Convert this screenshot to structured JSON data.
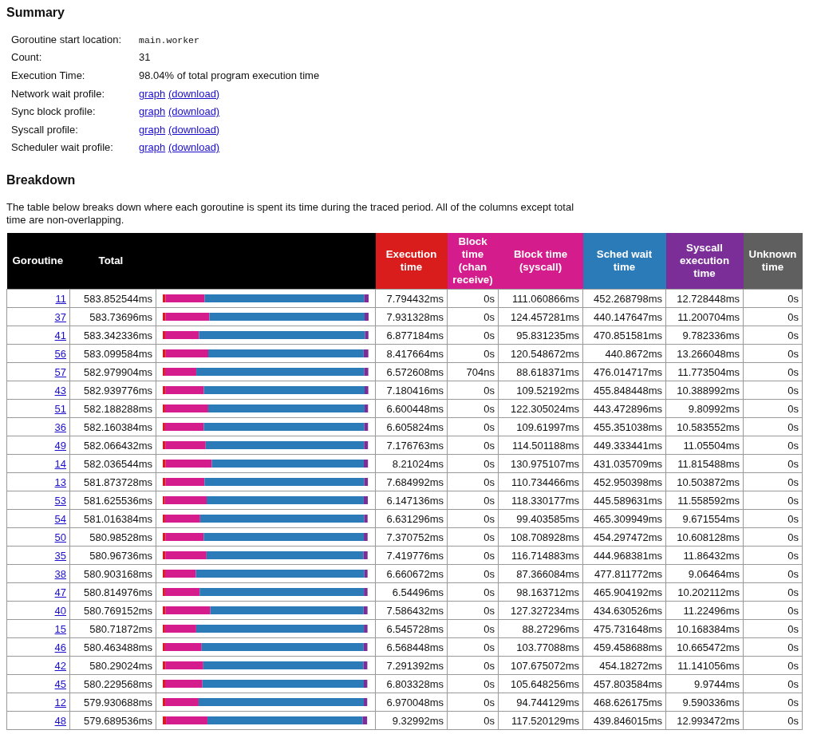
{
  "summary": {
    "heading": "Summary",
    "rows": [
      {
        "kind": "code",
        "label": "Goroutine start location:",
        "value": "main.worker"
      },
      {
        "kind": "text",
        "label": "Count:",
        "value": "31"
      },
      {
        "kind": "text",
        "label": "Execution Time:",
        "value": "98.04% of total program execution time"
      },
      {
        "kind": "links",
        "label": "Network wait profile:",
        "links": [
          "graph",
          "(download)"
        ]
      },
      {
        "kind": "links",
        "label": "Sync block profile:",
        "links": [
          "graph",
          "(download)"
        ]
      },
      {
        "kind": "links",
        "label": "Syscall profile:",
        "links": [
          "graph",
          "(download)"
        ]
      },
      {
        "kind": "links",
        "label": "Scheduler wait profile:",
        "links": [
          "graph",
          "(download)"
        ]
      }
    ]
  },
  "breakdown": {
    "heading": "Breakdown",
    "description": "The table below breaks down where each goroutine is spent its time during the traced period. All of the columns except total time are non-overlapping."
  },
  "table": {
    "columns": [
      {
        "label": "Goroutine",
        "color": "#000000"
      },
      {
        "label": "Total",
        "color": "#000000"
      },
      {
        "label": "Execution time",
        "color": "#d91c1c"
      },
      {
        "label": "Block time (chan receive)",
        "color": "#d41c8c"
      },
      {
        "label": "Block time (syscall)",
        "color": "#d41c8c"
      },
      {
        "label": "Sched wait time",
        "color": "#2b7bb9"
      },
      {
        "label": "Syscall execution time",
        "color": "#7b2e98"
      },
      {
        "label": "Unknown time",
        "color": "#5f5f5f"
      }
    ],
    "rows": [
      {
        "cells": [
          "11",
          "583.852544ms",
          "7.794432ms",
          "0s",
          "111.060866ms",
          "452.268798ms",
          "12.728448ms",
          "0s"
        ]
      },
      {
        "cells": [
          "37",
          "583.73696ms",
          "7.931328ms",
          "0s",
          "124.457281ms",
          "440.147647ms",
          "11.200704ms",
          "0s"
        ]
      },
      {
        "cells": [
          "41",
          "583.342336ms",
          "6.877184ms",
          "0s",
          "95.831235ms",
          "470.851581ms",
          "9.782336ms",
          "0s"
        ]
      },
      {
        "cells": [
          "56",
          "583.099584ms",
          "8.417664ms",
          "0s",
          "120.548672ms",
          "440.8672ms",
          "13.266048ms",
          "0s"
        ]
      },
      {
        "cells": [
          "57",
          "582.979904ms",
          "6.572608ms",
          "704ns",
          "88.618371ms",
          "476.014717ms",
          "11.773504ms",
          "0s"
        ]
      },
      {
        "cells": [
          "43",
          "582.939776ms",
          "7.180416ms",
          "0s",
          "109.52192ms",
          "455.848448ms",
          "10.388992ms",
          "0s"
        ]
      },
      {
        "cells": [
          "51",
          "582.188288ms",
          "6.600448ms",
          "0s",
          "122.305024ms",
          "443.472896ms",
          "9.80992ms",
          "0s"
        ]
      },
      {
        "cells": [
          "36",
          "582.160384ms",
          "6.605824ms",
          "0s",
          "109.61997ms",
          "455.351038ms",
          "10.583552ms",
          "0s"
        ]
      },
      {
        "cells": [
          "49",
          "582.066432ms",
          "7.176763ms",
          "0s",
          "114.501188ms",
          "449.333441ms",
          "11.05504ms",
          "0s"
        ]
      },
      {
        "cells": [
          "14",
          "582.036544ms",
          "8.21024ms",
          "0s",
          "130.975107ms",
          "431.035709ms",
          "11.815488ms",
          "0s"
        ]
      },
      {
        "cells": [
          "13",
          "581.873728ms",
          "7.684992ms",
          "0s",
          "110.734466ms",
          "452.950398ms",
          "10.503872ms",
          "0s"
        ]
      },
      {
        "cells": [
          "53",
          "581.625536ms",
          "6.147136ms",
          "0s",
          "118.330177ms",
          "445.589631ms",
          "11.558592ms",
          "0s"
        ]
      },
      {
        "cells": [
          "54",
          "581.016384ms",
          "6.631296ms",
          "0s",
          "99.403585ms",
          "465.309949ms",
          "9.671554ms",
          "0s"
        ]
      },
      {
        "cells": [
          "50",
          "580.98528ms",
          "7.370752ms",
          "0s",
          "108.708928ms",
          "454.297472ms",
          "10.608128ms",
          "0s"
        ]
      },
      {
        "cells": [
          "35",
          "580.96736ms",
          "7.419776ms",
          "0s",
          "116.714883ms",
          "444.968381ms",
          "11.86432ms",
          "0s"
        ]
      },
      {
        "cells": [
          "38",
          "580.903168ms",
          "6.660672ms",
          "0s",
          "87.366084ms",
          "477.811772ms",
          "9.06464ms",
          "0s"
        ]
      },
      {
        "cells": [
          "47",
          "580.814976ms",
          "6.54496ms",
          "0s",
          "98.163712ms",
          "465.904192ms",
          "10.202112ms",
          "0s"
        ]
      },
      {
        "cells": [
          "40",
          "580.769152ms",
          "7.586432ms",
          "0s",
          "127.327234ms",
          "434.630526ms",
          "11.22496ms",
          "0s"
        ]
      },
      {
        "cells": [
          "15",
          "580.71872ms",
          "6.545728ms",
          "0s",
          "88.27296ms",
          "475.731648ms",
          "10.168384ms",
          "0s"
        ]
      },
      {
        "cells": [
          "46",
          "580.463488ms",
          "6.568448ms",
          "0s",
          "103.77088ms",
          "459.458688ms",
          "10.665472ms",
          "0s"
        ]
      },
      {
        "cells": [
          "42",
          "580.29024ms",
          "7.291392ms",
          "0s",
          "107.675072ms",
          "454.18272ms",
          "11.141056ms",
          "0s"
        ]
      },
      {
        "cells": [
          "45",
          "580.229568ms",
          "6.803328ms",
          "0s",
          "105.648256ms",
          "457.803584ms",
          "9.9744ms",
          "0s"
        ]
      },
      {
        "cells": [
          "12",
          "579.930688ms",
          "6.970048ms",
          "0s",
          "94.744129ms",
          "468.626175ms",
          "9.590336ms",
          "0s"
        ]
      },
      {
        "cells": [
          "48",
          "579.689536ms",
          "9.32992ms",
          "0s",
          "117.520129ms",
          "439.846015ms",
          "12.993472ms",
          "0s"
        ]
      }
    ]
  }
}
